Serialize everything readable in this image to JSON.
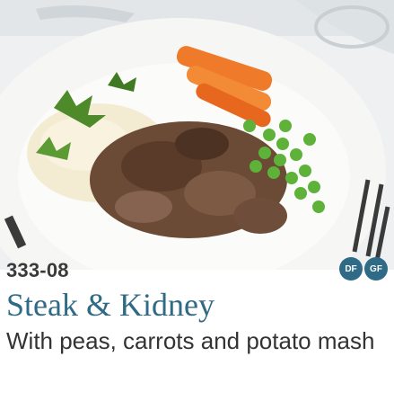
{
  "product": {
    "code": "333-08",
    "name": "Steak & Kidney",
    "description": "With peas, carrots and potato mash",
    "badges": [
      {
        "label": "DF",
        "color": "#2f6b86"
      },
      {
        "label": "GF",
        "color": "#2f6b86"
      }
    ]
  },
  "photo": {
    "subject": "plate of steak and kidney with peas, carrots and mashed potato"
  }
}
